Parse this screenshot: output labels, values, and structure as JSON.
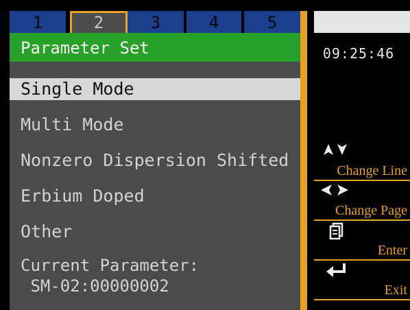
{
  "tabs": [
    {
      "label": "1",
      "active": false
    },
    {
      "label": "2",
      "active": true
    },
    {
      "label": "3",
      "active": false
    },
    {
      "label": "4",
      "active": false
    },
    {
      "label": "5",
      "active": false
    }
  ],
  "title": "Parameter Set",
  "menu": [
    {
      "label": "Single Mode",
      "selected": true
    },
    {
      "label": "Multi Mode",
      "selected": false
    },
    {
      "label": "Nonzero Dispersion Shifted",
      "selected": false
    },
    {
      "label": "Erbium Doped",
      "selected": false
    },
    {
      "label": "Other",
      "selected": false
    }
  ],
  "current": {
    "label": "Current Parameter:",
    "value": "SM-02:00000002"
  },
  "status": {
    "time": "09:25:46"
  },
  "hints": [
    {
      "icon": "up-down-arrows-icon",
      "label": "Change Line"
    },
    {
      "icon": "left-right-arrows-icon",
      "label": "Change Page"
    },
    {
      "icon": "document-icon",
      "label": "Enter"
    },
    {
      "icon": "return-arrow-icon",
      "label": "Exit"
    }
  ],
  "colors": {
    "tab_inactive": "#1a3f8c",
    "accent_orange": "#e8a020",
    "title_green": "#27a128",
    "panel_grey": "#4b4b4b",
    "selection": "#d7d7d7"
  }
}
